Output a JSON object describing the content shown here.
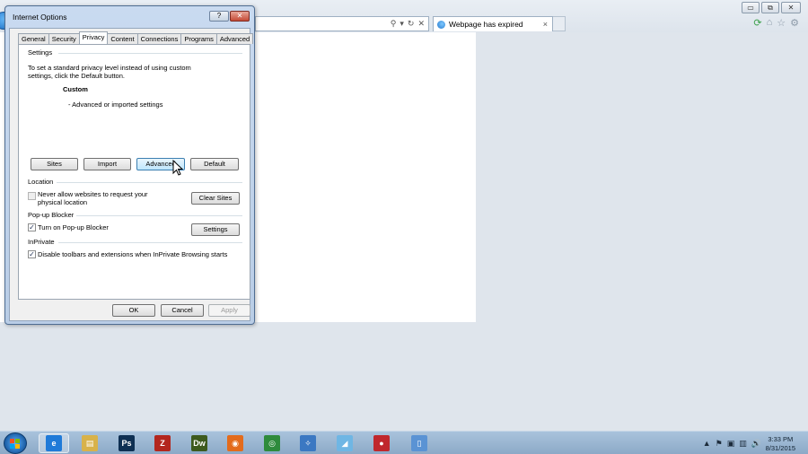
{
  "browser": {
    "tab_title": "Webpage has expired",
    "tab_close": "×",
    "window_controls": {
      "minimize": "▭",
      "restore": "⧉",
      "close": "✕"
    },
    "address_icons": {
      "search": "⚲",
      "dropdown": "▾",
      "refresh": "↻",
      "stop": "✕"
    },
    "right_icons": [
      "⟳",
      "⌂",
      "☆",
      "⚙"
    ]
  },
  "dialog": {
    "title": "Internet Options",
    "help_label": "?",
    "close_label": "✕",
    "tabs": [
      {
        "label": "General"
      },
      {
        "label": "Security"
      },
      {
        "label": "Privacy",
        "active": true
      },
      {
        "label": "Content"
      },
      {
        "label": "Connections"
      },
      {
        "label": "Programs"
      },
      {
        "label": "Advanced"
      }
    ],
    "settings": {
      "group_label": "Settings",
      "description_line1": "To set a standard privacy level instead of using custom",
      "description_line2": "settings, click the Default button.",
      "level_name": "Custom",
      "level_detail": "- Advanced or imported settings",
      "buttons": {
        "sites": "Sites",
        "import": "Import",
        "advanced": "Advanced",
        "default": "Default"
      }
    },
    "location": {
      "group_label": "Location",
      "checkbox_line1": "Never allow websites to request your",
      "checkbox_line2": "physical location",
      "checked": false,
      "clear_sites": "Clear Sites"
    },
    "popup": {
      "group_label": "Pop-up Blocker",
      "checkbox_label": "Turn on Pop-up Blocker",
      "checked": true,
      "settings": "Settings"
    },
    "inprivate": {
      "group_label": "InPrivate",
      "checkbox_label": "Disable toolbars and extensions when InPrivate Browsing starts",
      "checked": true
    },
    "footer": {
      "ok": "OK",
      "cancel": "Cancel",
      "apply": "Apply"
    }
  },
  "taskbar": {
    "apps": [
      {
        "name": "internet-explorer",
        "glyph": "e",
        "color": "#1f7ad8",
        "active": true
      },
      {
        "name": "file-explorer",
        "glyph": "▤",
        "color": "#d8b24a"
      },
      {
        "name": "photoshop",
        "glyph": "Ps",
        "color": "#0e2f52"
      },
      {
        "name": "filezilla",
        "glyph": "Z",
        "color": "#b3261e"
      },
      {
        "name": "dreamweaver",
        "glyph": "Dw",
        "color": "#3d5a1e"
      },
      {
        "name": "firefox",
        "glyph": "◉",
        "color": "#e36b1c"
      },
      {
        "name": "chrome",
        "glyph": "◎",
        "color": "#2e8b3c"
      },
      {
        "name": "safari",
        "glyph": "✧",
        "color": "#3b78c2"
      },
      {
        "name": "app-blue",
        "glyph": "◢",
        "color": "#6fb6e4"
      },
      {
        "name": "app-red",
        "glyph": "●",
        "color": "#c0272d"
      },
      {
        "name": "document",
        "glyph": "▯",
        "color": "#5a93d4"
      }
    ],
    "tray_icons": [
      "▲",
      "⚑",
      "▣",
      "▥",
      "🔊"
    ],
    "clock_time": "3:33 PM",
    "clock_date": "8/31/2015"
  }
}
